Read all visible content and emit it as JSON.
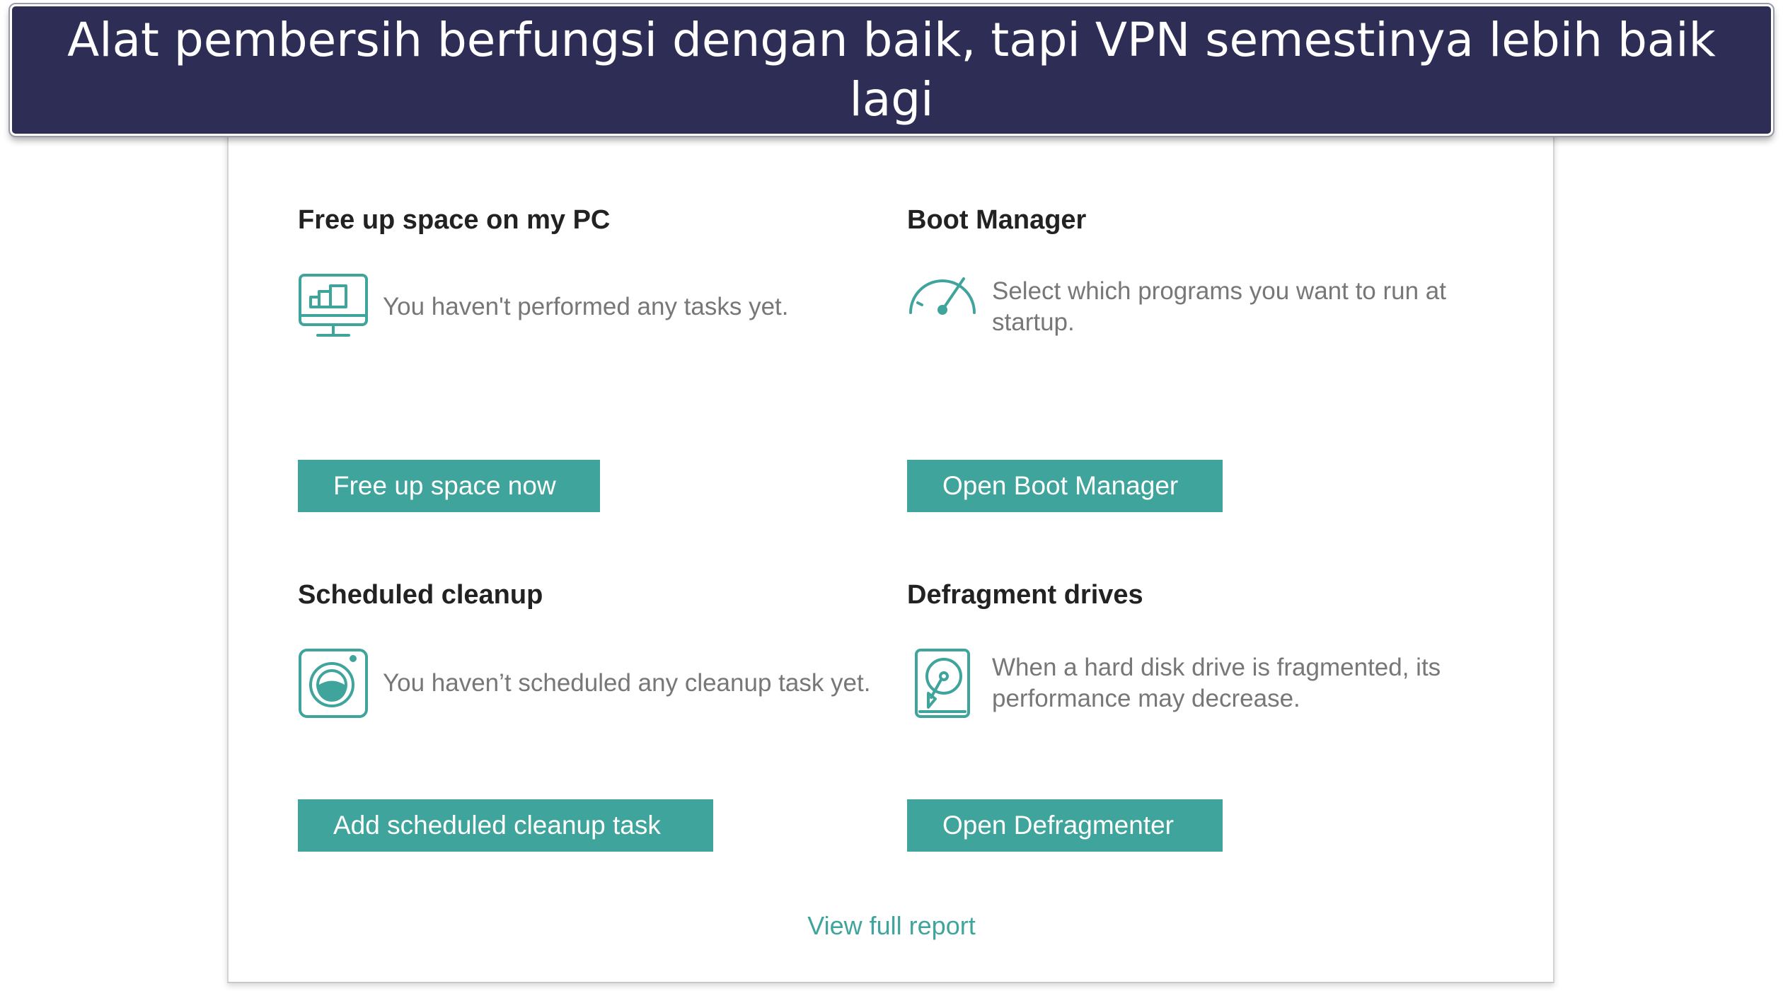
{
  "banner": {
    "caption": "Alat pembersih berfungsi dengan baik, tapi VPN semestinya lebih baik lagi"
  },
  "colors": {
    "accent": "#3fa59c",
    "banner_bg": "#2d2d55",
    "title_text": "#222222",
    "desc_text": "#777777"
  },
  "sections": {
    "free_space": {
      "title": "Free up space on my PC",
      "description": "You haven't performed any tasks yet.",
      "button": "Free up space now",
      "icon": "monitor-icon"
    },
    "boot_manager": {
      "title": "Boot Manager",
      "description": "Select which programs you want to run at startup.",
      "button": "Open Boot Manager",
      "icon": "speedometer-icon"
    },
    "scheduled_cleanup": {
      "title": "Scheduled cleanup",
      "description": "You haven’t scheduled any cleanup task yet.",
      "button": "Add scheduled cleanup task",
      "icon": "washing-machine-icon"
    },
    "defragment": {
      "title": "Defragment drives",
      "description": "When a hard disk drive is fragmented, its performance may decrease.",
      "button": "Open Defragmenter",
      "icon": "hard-drive-icon"
    }
  },
  "footer": {
    "link": "View full report"
  }
}
